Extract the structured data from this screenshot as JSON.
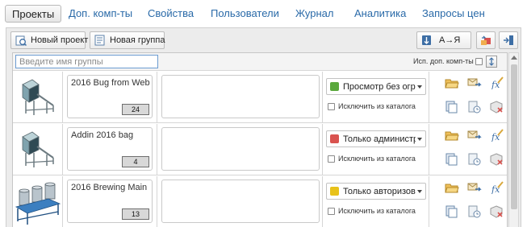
{
  "nav": {
    "tabs": [
      {
        "label": "Проекты",
        "active": true
      },
      {
        "label": "Доп. комп-ты"
      },
      {
        "label": "Свойства"
      },
      {
        "label": "Пользователи"
      },
      {
        "label": "Журнал"
      },
      {
        "label": "Аналитика"
      },
      {
        "label": "Запросы цен"
      }
    ]
  },
  "toolbar": {
    "new_project_label": "Новый проект",
    "new_group_label": "Новая группа",
    "sort_label": "А→Я",
    "icons": [
      "new-project-icon",
      "new-group-icon",
      "sort-az-icon",
      "import-icon",
      "export-icon"
    ]
  },
  "filter": {
    "placeholder": "Введите имя группы",
    "include_components_label": "Исп. доп. комп-ты"
  },
  "groups": [
    {
      "name": "2016 Bug from Web",
      "count": "24",
      "description": "",
      "permission": "Просмотр без огра...",
      "permission_color": "#5aa83c",
      "exclude_label": "Исключить из каталога"
    },
    {
      "name": "Addin 2016 bag",
      "count": "4",
      "description": "",
      "permission": "Только администр...",
      "permission_color": "#d9534f",
      "exclude_label": "Исключить из каталога"
    },
    {
      "name": "2016 Brewing Main",
      "count": "13",
      "description": "",
      "permission": "Только авторизова...",
      "permission_color": "#e8c21a",
      "exclude_label": "Исключить из каталога"
    }
  ],
  "colors": {
    "link": "#2a6aa8",
    "panel_bg": "#ececec",
    "focus_border": "#6b9bd1"
  }
}
